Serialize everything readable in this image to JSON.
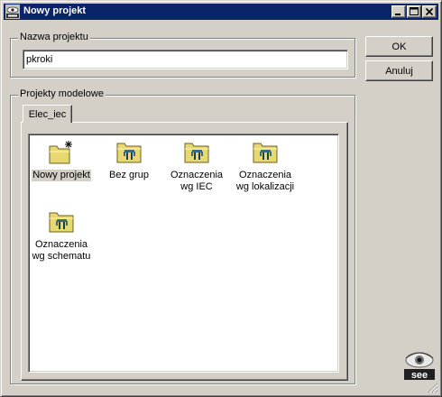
{
  "window": {
    "title": "Nowy projekt",
    "app_icon": "see-logo-icon",
    "controls": {
      "minimize": "minimize-icon",
      "maximize": "maximize-icon",
      "close": "close-icon"
    }
  },
  "project_name": {
    "group_label": "Nazwa projektu",
    "value": "pkroki"
  },
  "buttons": {
    "ok": "OK",
    "cancel": "Anuluj"
  },
  "models": {
    "group_label": "Projekty modelowe",
    "tabs": [
      {
        "label": "Elec_iec",
        "active": true
      }
    ],
    "items": [
      {
        "label": "Nowy projekt",
        "icon": "new-folder-icon",
        "selected": true
      },
      {
        "label": "Bez grup",
        "icon": "template-folder-icon"
      },
      {
        "label": "Oznaczenia wg IEC",
        "icon": "template-folder-icon"
      },
      {
        "label": "Oznaczenia wg lokalizacji",
        "icon": "template-folder-icon"
      },
      {
        "label": "Oznaczenia wg schematu",
        "icon": "template-folder-icon"
      }
    ]
  },
  "brand": {
    "logo": "see-logo",
    "logo_text": "see"
  },
  "colors": {
    "titlebar": "#0a246a",
    "face": "#d4d0c8",
    "folder": "#e8d870"
  }
}
